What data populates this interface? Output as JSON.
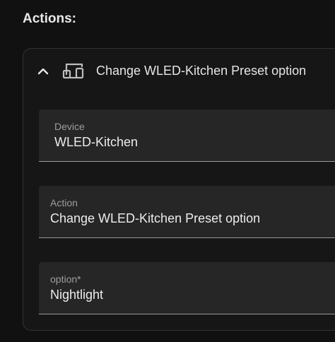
{
  "section": {
    "title": "Actions:"
  },
  "action_card": {
    "header_title": "Change WLED-Kitchen Preset option",
    "chevron_icon": "chevron-up-icon",
    "device_icon": "devices-icon"
  },
  "fields": {
    "device": {
      "label": "Device",
      "value": "WLED-Kitchen"
    },
    "action": {
      "label": "Action",
      "value": "Change WLED-Kitchen Preset option"
    },
    "option": {
      "label": "option*",
      "value": "Nightlight"
    }
  },
  "colors": {
    "background": "#111111",
    "card_background": "#161616",
    "field_background": "#262626",
    "text": "#e1e1e1",
    "label": "#9e9e9e"
  }
}
